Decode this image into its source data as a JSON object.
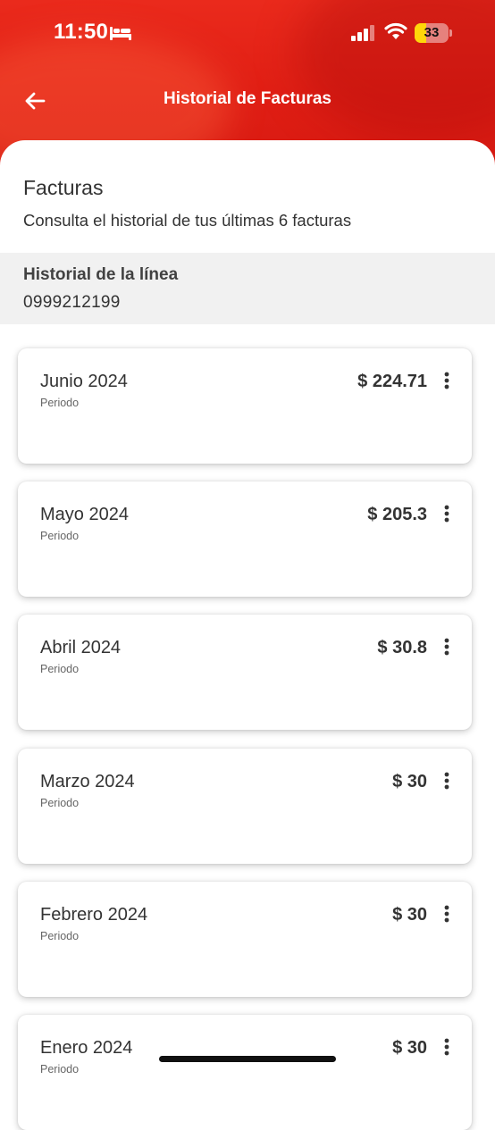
{
  "status_bar": {
    "time": "11:50",
    "battery_level": "33",
    "icons": [
      "bed-icon",
      "signal-icon",
      "wifi-icon",
      "battery-icon"
    ]
  },
  "nav": {
    "title": "Historial de Facturas",
    "back_icon": "arrow-left-icon"
  },
  "intro": {
    "title": "Facturas",
    "subtitle": "Consulta el historial de tus últimas 6 facturas"
  },
  "line": {
    "label": "Historial de la línea",
    "number": "0999212199"
  },
  "invoices": [
    {
      "period": "Junio 2024",
      "period_label": "Periodo",
      "amount": "$ 224.71"
    },
    {
      "period": "Mayo 2024",
      "period_label": "Periodo",
      "amount": "$ 205.3"
    },
    {
      "period": "Abril 2024",
      "period_label": "Periodo",
      "amount": "$ 30.8"
    },
    {
      "period": "Marzo 2024",
      "period_label": "Periodo",
      "amount": "$ 30"
    },
    {
      "period": "Febrero 2024",
      "period_label": "Periodo",
      "amount": "$ 30"
    },
    {
      "period": "Enero 2024",
      "period_label": "Periodo",
      "amount": "$ 30"
    }
  ],
  "colors": {
    "brand_red": "#e01e14",
    "battery_yellow": "#ffd60a"
  }
}
